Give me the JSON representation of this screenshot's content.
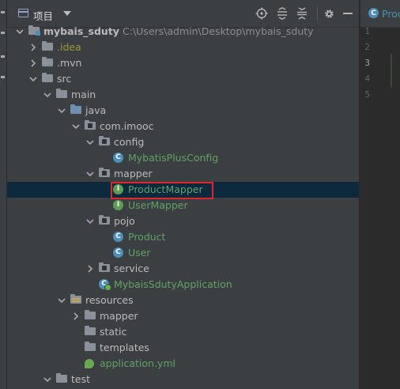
{
  "panel": {
    "title": "项目"
  },
  "tree": [
    {
      "label": "mybais_sduty",
      "path": "C:\\Users\\admin\\Desktop\\mybais_sduty",
      "kind": "project",
      "expanded": true
    },
    {
      "label": ".idea",
      "kind": "folder",
      "color": "yellow",
      "expanded": false
    },
    {
      "label": ".mvn",
      "kind": "folder",
      "expanded": false
    },
    {
      "label": "src",
      "kind": "folder",
      "expanded": true
    },
    {
      "label": "main",
      "kind": "folder",
      "expanded": true
    },
    {
      "label": "java",
      "kind": "source-folder",
      "expanded": true
    },
    {
      "label": "com.imooc",
      "kind": "package",
      "expanded": true
    },
    {
      "label": "config",
      "kind": "package",
      "expanded": true
    },
    {
      "label": "MybatisPlusConfig",
      "kind": "class",
      "color": "green"
    },
    {
      "label": "mapper",
      "kind": "package",
      "expanded": true
    },
    {
      "label": "ProductMapper",
      "kind": "interface",
      "color": "green",
      "selected": true,
      "highlighted": true
    },
    {
      "label": "UserMapper",
      "kind": "interface",
      "color": "green"
    },
    {
      "label": "pojo",
      "kind": "package",
      "expanded": true
    },
    {
      "label": "Product",
      "kind": "class",
      "color": "green"
    },
    {
      "label": "User",
      "kind": "class",
      "color": "green"
    },
    {
      "label": "service",
      "kind": "package",
      "expanded": false
    },
    {
      "label": "MybaisSdutyApplication",
      "kind": "spring-app",
      "color": "green"
    },
    {
      "label": "resources",
      "kind": "resources-folder",
      "expanded": true
    },
    {
      "label": "mapper",
      "kind": "folder",
      "expanded": false
    },
    {
      "label": "static",
      "kind": "folder"
    },
    {
      "label": "templates",
      "kind": "folder"
    },
    {
      "label": "application.yml",
      "kind": "yml",
      "color": "green"
    },
    {
      "label": "test",
      "kind": "folder",
      "expanded": true
    }
  ],
  "editor": {
    "tab_label": "Prod",
    "line_numbers": [
      "1",
      "2",
      "3",
      "4",
      "5"
    ],
    "current_line": "3"
  },
  "colors": {
    "selection": "#0d293e",
    "highlight_box": "#e0262b",
    "vcs_green": "#62a065",
    "vcs_yellow": "#9c9a3b"
  }
}
